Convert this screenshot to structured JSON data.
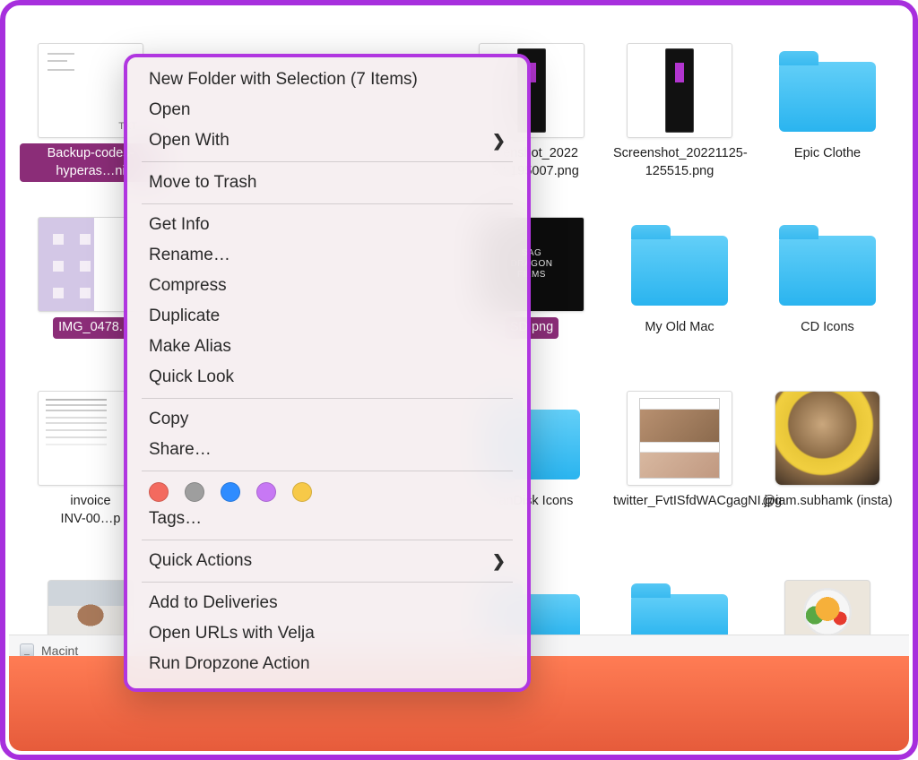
{
  "statusbar": {
    "disk_label": "Macint"
  },
  "files": {
    "r0c0": {
      "label": "Backup-codes-hyperas…ni",
      "selected": true
    },
    "r0c3": {
      "label": "Screenshot_20221123-195007.png",
      "selected": false,
      "partial": "creenshot_2022\n123-195007.png"
    },
    "r0c4": {
      "label": "Screenshot_20221125-125515.png",
      "selected": false
    },
    "r0c5": {
      "label": "Epic Clothe",
      "selected": false
    },
    "r1c0": {
      "label": "IMG_0478.",
      "selected": true
    },
    "r1c3": {
      "label": "SD.png",
      "selected": true
    },
    "r1c4": {
      "label": "My Old Mac",
      "selected": false
    },
    "r1c5": {
      "label": "CD Icons",
      "selected": false
    },
    "r2c0": {
      "label": "invoice\nINV-00…p",
      "selected": false
    },
    "r2c3": {
      "label": "SanDisk Icons",
      "selected": false,
      "partial": "SanDisk Icons"
    },
    "r2c4": {
      "label": "twitter_FvtISfdWACgagNI.jpg",
      "selected": false
    },
    "r2c5": {
      "label": "@iam.subhamk (insta)",
      "selected": false
    },
    "r3c3": {
      "label": "",
      "selected": false
    },
    "r3c4": {
      "label": "",
      "selected": false
    },
    "r3c5": {
      "label": "",
      "selected": false
    }
  },
  "menu": {
    "newFolder": "New Folder with Selection (7 Items)",
    "open": "Open",
    "openWith": "Open With",
    "moveToTrash": "Move to Trash",
    "getInfo": "Get Info",
    "rename": "Rename…",
    "compress": "Compress",
    "duplicate": "Duplicate",
    "makeAlias": "Make Alias",
    "quickLook": "Quick Look",
    "copy": "Copy",
    "share": "Share…",
    "tags": "Tags…",
    "quickActions": "Quick Actions",
    "addDeliveries": "Add to Deliveries",
    "openUrls": "Open URLs with Velja",
    "runDropzone": "Run Dropzone Action"
  },
  "tagColors": [
    "red",
    "gray",
    "blue",
    "purple",
    "yellow"
  ]
}
